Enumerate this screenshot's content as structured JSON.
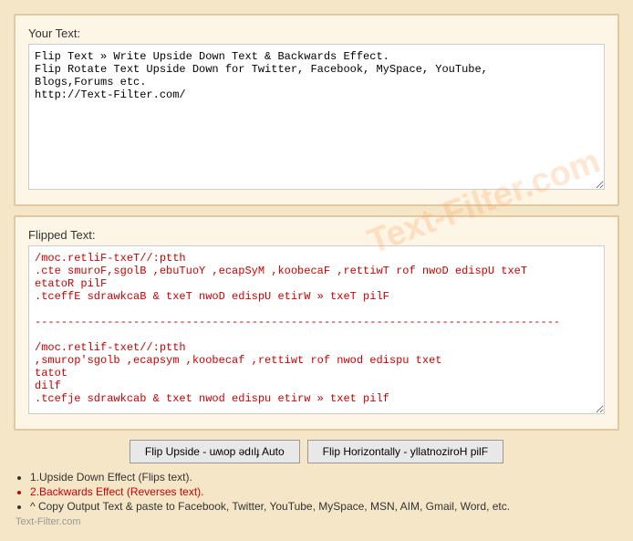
{
  "watermark": "Text-Filter.com",
  "your_text": {
    "label": "Your Text:",
    "value": "Flip Text » Write Upside Down Text & Backwards Effect.\nFlip Rotate Text Upside Down for Twitter, Facebook, MySpace, YouTube,\nBlogs,Forums etc.\nhttp://Text-Filter.com/"
  },
  "flipped_text": {
    "label": "Flipped Text:",
    "value": "/moc.retliF-txeT//:ptth\n.cte smuroF,sgolB ,ebuTuoY ,ecapSyM ,koobecaF ,rettiwT rof nwoD edispU txeT\netatoR pilF\n.tceffE sdrawkcaB & txeT nwoD edispU etirW » txeT pilF\n\n--------------------------------------------------------------------------------\n\n/moc.retlif-txet//:ptth\n,smurop'sgolb ,ecapsym ,koobecaf ,rettiwt rof nwod edispu txet\ntatot\ndilf\n.tcefje sdrawkcab & txet nwod edispu etirw » txet pilf"
  },
  "buttons": {
    "flip_upside": "Flip Upside - uʍop ǝdılɟ Auto",
    "flip_horizontal": "Flip Horizontally - yllatnoziroH pilF"
  },
  "notes": {
    "items": [
      {
        "text": "1.Upside Down Effect (Flips text).",
        "style": "normal"
      },
      {
        "text": "2.Backwards Effect (Reverses text).",
        "style": "red"
      },
      {
        "text": "^ Copy Output Text & paste to Facebook, Twitter, YouTube, MySpace, MSN, AIM, Gmail, Word, etc.",
        "style": "normal"
      }
    ],
    "footer": "Text-Filter.com"
  }
}
